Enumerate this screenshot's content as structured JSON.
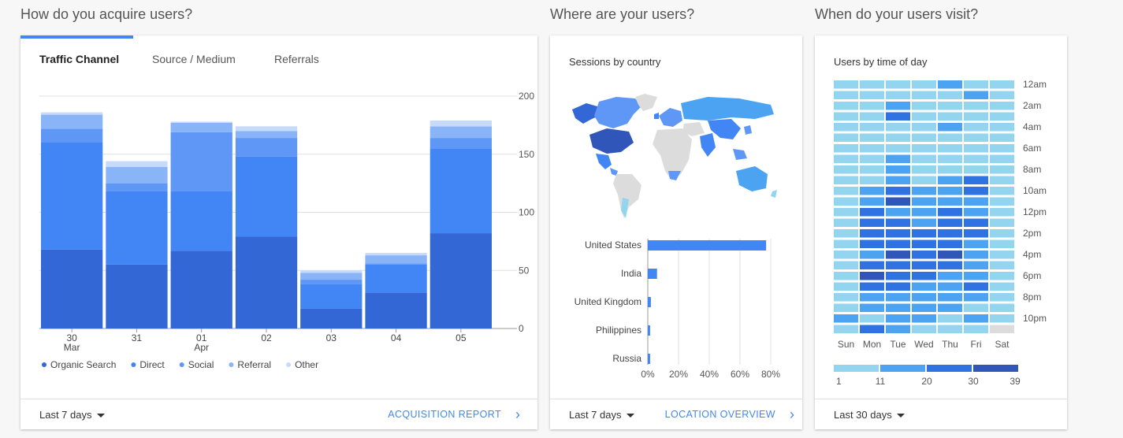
{
  "acquire": {
    "title": "How do you acquire users?",
    "tabs": [
      {
        "label": "Traffic Channel"
      },
      {
        "label": "Source / Medium"
      },
      {
        "label": "Referrals"
      }
    ],
    "footer": {
      "range": "Last 7 days",
      "link": "ACQUISITION REPORT"
    }
  },
  "where": {
    "title": "Where are your users?",
    "subtitle": "Sessions by country",
    "footer": {
      "range": "Last 7 days",
      "link": "LOCATION OVERVIEW"
    }
  },
  "when": {
    "title": "When do your users visit?",
    "subtitle": "Users by time of day",
    "footer": {
      "range": "Last 30 days"
    }
  },
  "chart_data": [
    {
      "type": "bar",
      "stacked": true,
      "categories": [
        "30 Mar",
        "31",
        "01 Apr",
        "02",
        "03",
        "04",
        "05"
      ],
      "category_lines": [
        [
          "30",
          "Mar"
        ],
        [
          "31"
        ],
        [
          "01",
          "Apr"
        ],
        [
          "02"
        ],
        [
          "03"
        ],
        [
          "04"
        ],
        [
          "05"
        ]
      ],
      "ylim": [
        0,
        200
      ],
      "yticks": [
        0,
        50,
        100,
        150,
        200
      ],
      "series": [
        {
          "name": "Organic Search",
          "color": "#3367d6",
          "values": [
            68,
            55,
            67,
            79,
            17,
            31,
            82
          ]
        },
        {
          "name": "Direct",
          "color": "#4285f4",
          "values": [
            92,
            63,
            51,
            69,
            21,
            24,
            73
          ]
        },
        {
          "name": "Social",
          "color": "#5e97f6",
          "values": [
            12,
            7,
            51,
            16,
            4,
            1,
            9
          ]
        },
        {
          "name": "Referral",
          "color": "#8ab4f8",
          "values": [
            12,
            14,
            8,
            6,
            6,
            7,
            10
          ]
        },
        {
          "name": "Other",
          "color": "#c6dafc",
          "values": [
            2,
            5,
            1,
            4,
            2,
            2,
            5
          ]
        }
      ],
      "legend_position": "bottom",
      "grid": true
    },
    {
      "type": "bar",
      "orientation": "horizontal",
      "categories": [
        "United States",
        "India",
        "United Kingdom",
        "Philippines",
        "Russia"
      ],
      "values": [
        77,
        6,
        2,
        1.5,
        1.5
      ],
      "unit": "%",
      "xlim": [
        0,
        80
      ],
      "xticks": [
        "0%",
        "20%",
        "40%",
        "60%",
        "80%"
      ],
      "color": "#4285f4"
    },
    {
      "type": "heatmap",
      "columns": [
        "Sun",
        "Mon",
        "Tue",
        "Wed",
        "Thu",
        "Fri",
        "Sat"
      ],
      "row_labels": [
        "12am",
        "2am",
        "4am",
        "6am",
        "8am",
        "10am",
        "12pm",
        "2pm",
        "4pm",
        "6pm",
        "8pm",
        "10pm"
      ],
      "rows": 24,
      "legend": {
        "values": [
          "1",
          "11",
          "20",
          "30",
          "39"
        ],
        "colors": [
          "#93d4ef",
          "#4ba3f2",
          "#2f73e3",
          "#2f56b8"
        ]
      },
      "levels": [
        [
          0,
          0,
          0,
          0,
          1,
          0,
          0
        ],
        [
          0,
          0,
          0,
          0,
          0,
          1,
          0
        ],
        [
          0,
          0,
          1,
          0,
          0,
          0,
          0
        ],
        [
          0,
          0,
          2,
          0,
          0,
          0,
          0
        ],
        [
          0,
          0,
          0,
          0,
          1,
          0,
          0
        ],
        [
          0,
          0,
          0,
          0,
          0,
          0,
          0
        ],
        [
          0,
          0,
          0,
          0,
          0,
          0,
          0
        ],
        [
          0,
          0,
          1,
          0,
          0,
          0,
          0
        ],
        [
          0,
          0,
          1,
          0,
          0,
          0,
          0
        ],
        [
          0,
          0,
          1,
          0,
          1,
          2,
          0
        ],
        [
          0,
          1,
          2,
          1,
          1,
          2,
          0
        ],
        [
          0,
          1,
          3,
          1,
          1,
          1,
          0
        ],
        [
          0,
          2,
          1,
          1,
          2,
          1,
          0
        ],
        [
          0,
          2,
          2,
          1,
          2,
          2,
          0
        ],
        [
          0,
          2,
          2,
          2,
          2,
          2,
          0
        ],
        [
          0,
          2,
          2,
          2,
          2,
          1,
          0
        ],
        [
          0,
          1,
          3,
          2,
          3,
          1,
          0
        ],
        [
          0,
          2,
          2,
          2,
          2,
          1,
          0
        ],
        [
          0,
          3,
          2,
          2,
          1,
          1,
          0
        ],
        [
          0,
          2,
          2,
          1,
          1,
          2,
          0
        ],
        [
          0,
          1,
          1,
          1,
          1,
          1,
          0
        ],
        [
          0,
          1,
          1,
          1,
          1,
          0,
          0
        ],
        [
          1,
          0,
          1,
          1,
          0,
          1,
          0
        ],
        [
          0,
          2,
          1,
          0,
          0,
          0,
          0
        ]
      ],
      "empty_cell": {
        "row": 23,
        "col": 6,
        "color": "#dcdcdc"
      }
    }
  ]
}
